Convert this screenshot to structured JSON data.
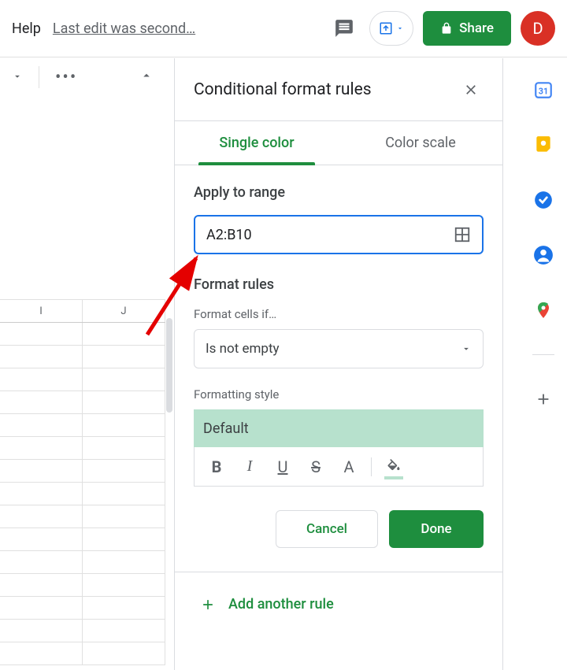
{
  "topbar": {
    "help": "Help",
    "last_edit": "Last edit was second…",
    "share": "Share",
    "avatar_letter": "D"
  },
  "sheet": {
    "columns": [
      "I",
      "J"
    ]
  },
  "panel": {
    "title": "Conditional format rules",
    "tabs": {
      "single": "Single color",
      "scale": "Color scale"
    },
    "apply_label": "Apply to range",
    "range_value": "A2:B10",
    "format_rules_label": "Format rules",
    "format_cells_if_label": "Format cells if…",
    "condition_value": "Is not empty",
    "formatting_style_label": "Formatting style",
    "style_preview": "Default",
    "cancel": "Cancel",
    "done": "Done",
    "add_rule": "Add another rule"
  },
  "sidepanel": {
    "calendar_day": "31"
  }
}
